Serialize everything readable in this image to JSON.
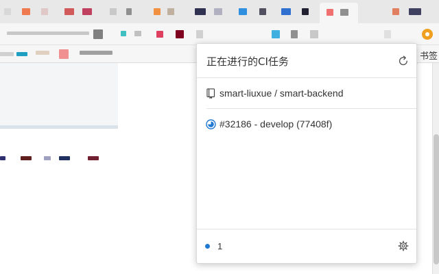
{
  "browser": {
    "bookmarks_label": "书签",
    "accent_gitlab": "#e24329",
    "accent_extension": "#f0a021"
  },
  "popup": {
    "title": "正在进行的CI任务",
    "project": {
      "icon": "repo-icon",
      "name": "smart-liuxue / smart-backend"
    },
    "jobs": [
      {
        "icon": "running-icon",
        "label": "#32186 - develop (77408f)"
      }
    ],
    "footer": {
      "indicator_color": "#1f78d1",
      "count": "1"
    },
    "icons": {
      "refresh": "refresh-icon",
      "settings": "gear-icon"
    }
  }
}
